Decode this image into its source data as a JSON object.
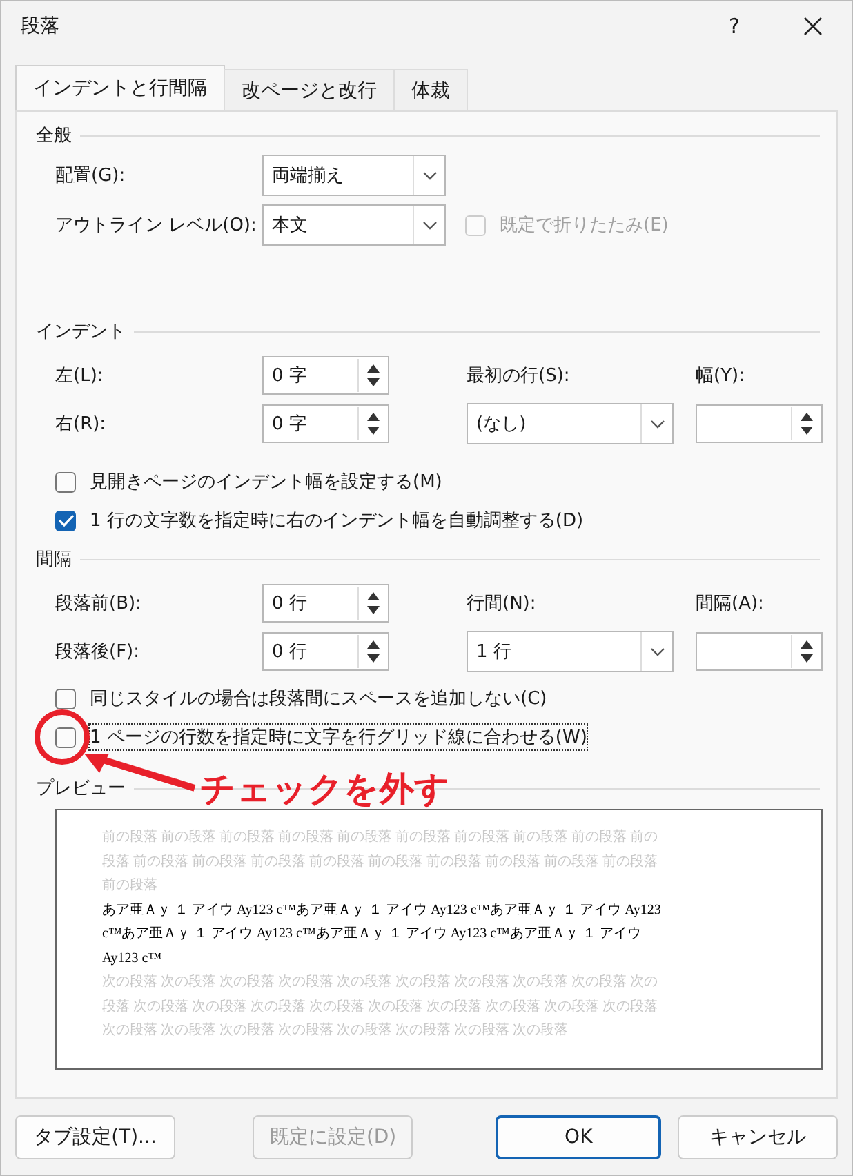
{
  "window": {
    "title": "段落",
    "help": "?"
  },
  "tabs": [
    {
      "label": "インデントと行間隔",
      "selected": true
    },
    {
      "label": "改ページと改行",
      "selected": false
    },
    {
      "label": "体裁",
      "selected": false
    }
  ],
  "general": {
    "heading": "全般",
    "alignment": {
      "label": "配置(G):",
      "value": "両端揃え"
    },
    "outline_level": {
      "label": "アウトライン レベル(O):",
      "value": "本文"
    },
    "collapsed": {
      "label": "既定で折りたたみ(E)",
      "checked": false,
      "disabled": true
    }
  },
  "indent": {
    "heading": "インデント",
    "left": {
      "label": "左(L):",
      "value": "0 字"
    },
    "right": {
      "label": "右(R):",
      "value": "0 字"
    },
    "first_line": {
      "label": "最初の行(S):",
      "value": "(なし)"
    },
    "by": {
      "label": "幅(Y):"
    },
    "mirror": {
      "label": "見開きページのインデント幅を設定する(M)",
      "checked": false
    },
    "auto_adjust": {
      "label": "1 行の文字数を指定時に右のインデント幅を自動調整する(D)",
      "checked": true
    }
  },
  "spacing": {
    "heading": "間隔",
    "before": {
      "label": "段落前(B):",
      "value": "0 行"
    },
    "after": {
      "label": "段落後(F):",
      "value": "0 行"
    },
    "line_spacing": {
      "label": "行間(N):",
      "value": "1 行"
    },
    "at": {
      "label": "間隔(A):"
    },
    "no_space": {
      "label": "同じスタイルの場合は段落間にスペースを追加しない(C)",
      "checked": false,
      "focused": false
    },
    "snap_grid": {
      "label": "1 ページの行数を指定時に文字を行グリッド線に合わせる(W)",
      "checked": false,
      "focused": true
    }
  },
  "preview": {
    "heading": "プレビュー",
    "previous_lines": [
      "前の段落 前の段落 前の段落 前の段落 前の段落 前の段落 前の段落 前の段落 前の段落 前の",
      "段落 前の段落 前の段落 前の段落 前の段落 前の段落 前の段落 前の段落 前の段落 前の段落",
      "前の段落"
    ],
    "sample_lines": [
      "あア亜Ａｙ １ アイウ Ay123 c™あア亜Ａｙ １ アイウ Ay123 c™あア亜Ａｙ １ アイウ Ay123",
      "c™あア亜Ａｙ １ アイウ Ay123 c™あア亜Ａｙ １ アイウ Ay123 c™あア亜Ａｙ １ アイウ",
      "Ay123 c™"
    ],
    "following_lines": [
      "次の段落 次の段落 次の段落 次の段落 次の段落 次の段落 次の段落 次の段落 次の段落 次の",
      "段落 次の段落 次の段落 次の段落 次の段落 次の段落 次の段落 次の段落 次の段落 次の段落",
      "次の段落 次の段落 次の段落 次の段落 次の段落 次の段落 次の段落 次の段落"
    ]
  },
  "buttons": [
    {
      "label": "タブ設定(T)...",
      "disabled": false,
      "default": false
    },
    {
      "label": "既定に設定(D)",
      "disabled": true,
      "default": false
    },
    {
      "label": "OK",
      "disabled": false,
      "default": true
    },
    {
      "label": "キャンセル",
      "disabled": false,
      "default": false
    }
  ],
  "annotation": {
    "text": "チェックを外す"
  }
}
